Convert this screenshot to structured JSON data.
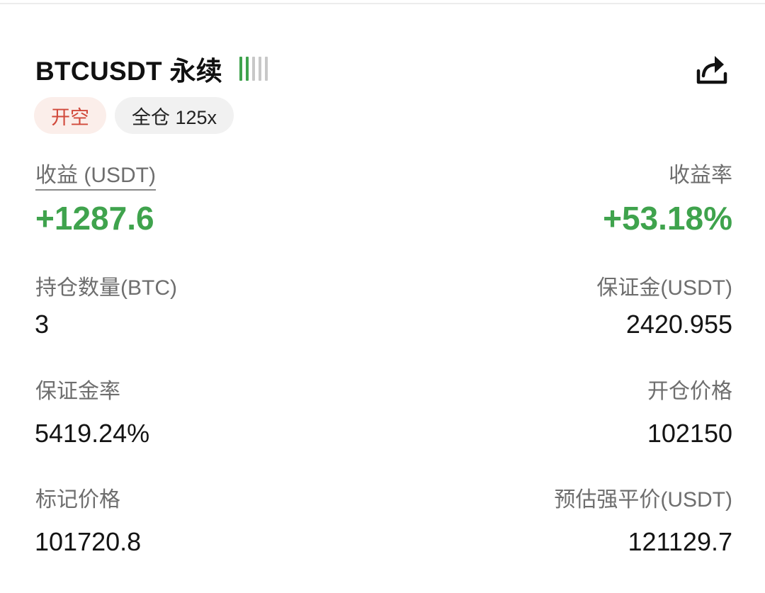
{
  "header": {
    "title": "BTCUSDT 永续",
    "liquidity_bars": {
      "active": 2,
      "total": 5
    },
    "share_icon": "share-icon"
  },
  "tags": {
    "direction": "开空",
    "margin_mode": "全仓 125x"
  },
  "pnl": {
    "label": "收益 (USDT)",
    "value": "+1287.6"
  },
  "roi": {
    "label": "收益率",
    "value": "+53.18%"
  },
  "position_size": {
    "label": "持仓数量(BTC)",
    "value": "3"
  },
  "margin": {
    "label": "保证金(USDT)",
    "value": "2420.955"
  },
  "margin_ratio": {
    "label": "保证金率",
    "value": "5419.24%"
  },
  "entry_price": {
    "label": "开仓价格",
    "value": "102150"
  },
  "mark_price": {
    "label": "标记价格",
    "value": "101720.8"
  },
  "liq_price": {
    "label": "预估强平价(USDT)",
    "value": "121129.7"
  },
  "colors": {
    "profit_green": "#3fa34d",
    "short_red": "#d1493b",
    "short_tag_bg": "#fbeeea",
    "margin_tag_bg": "#f1f1f1"
  }
}
